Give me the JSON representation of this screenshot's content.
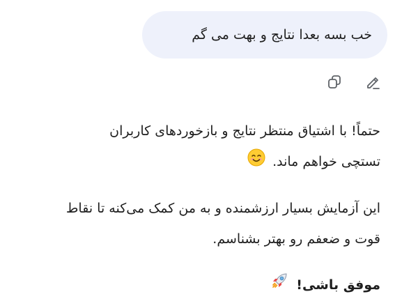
{
  "user_message": {
    "text": "خب بسه بعدا نتایج و بهت می گم"
  },
  "message_actions": {
    "copy_icon": "copy-icon",
    "edit_icon": "edit-pencil-icon"
  },
  "assistant_message": {
    "paragraph1": {
      "line1": "حتماً! با اشتیاق منتظر نتایج و بازخوردهای کاربران",
      "line2": "تستچی خواهم ماند.",
      "emoji_icon": "smiling-face-emoji"
    },
    "paragraph2": {
      "line1": "این آزمایش بسیار ارزشمنده و به من کمک می‌کنه تا نقاط",
      "line2": "قوت و ضعفم رو بهتر بشناسم."
    },
    "paragraph3": {
      "text": "موفق باشی!",
      "emoji_icon": "rocket-emoji"
    }
  },
  "colors": {
    "bubble_bg": "#eef1fb",
    "text": "#1f1f1f",
    "icon": "#5f6368"
  }
}
